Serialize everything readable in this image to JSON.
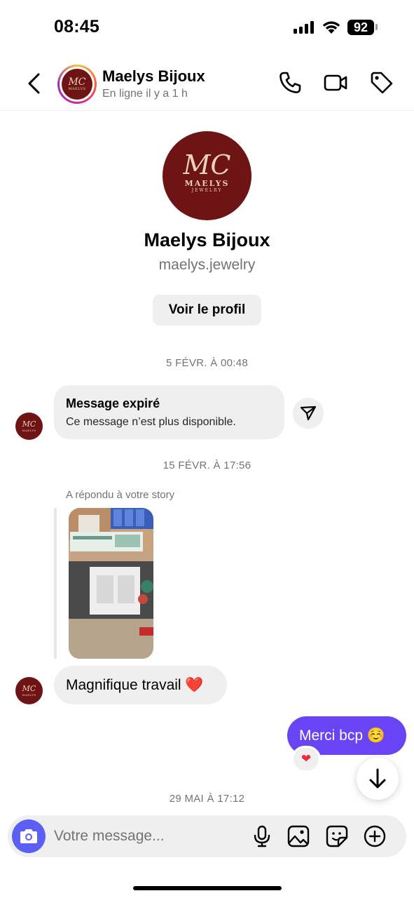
{
  "status_bar": {
    "time": "08:45",
    "battery": "92"
  },
  "header": {
    "contact_name": "Maelys Bijoux",
    "status": "En ligne il y a 1 h",
    "icons": [
      "back-icon",
      "phone-icon",
      "video-icon",
      "tag-icon"
    ]
  },
  "logo": {
    "monogram": "MC",
    "word": "MAELYS",
    "sub": "JEWELRY"
  },
  "profile": {
    "name": "Maelys Bijoux",
    "handle": "maelys.jewelry",
    "view_profile_label": "Voir le profil"
  },
  "messages": {
    "timestamp_1": "5 FÉVR. À 00:48",
    "expired_title": "Message expiré",
    "expired_body": "Ce message n’est plus disponible.",
    "timestamp_2": "15 FÉVR. À 17:56",
    "story_reply_label": "A répondu à votre story",
    "received_text": "Magnifique travail ❤️",
    "sent_text": "Merci bcp ☺️",
    "reaction": "❤",
    "timestamp_3": "29 MAI À 17:12"
  },
  "composer": {
    "placeholder": "Votre message...",
    "icons": [
      "camera-icon",
      "microphone-icon",
      "gallery-icon",
      "sticker-icon",
      "plus-icon"
    ]
  },
  "colors": {
    "accent": "#6844f5",
    "camera": "#5b5ff4",
    "brand": "#6e1414",
    "bubble": "#efefef"
  }
}
